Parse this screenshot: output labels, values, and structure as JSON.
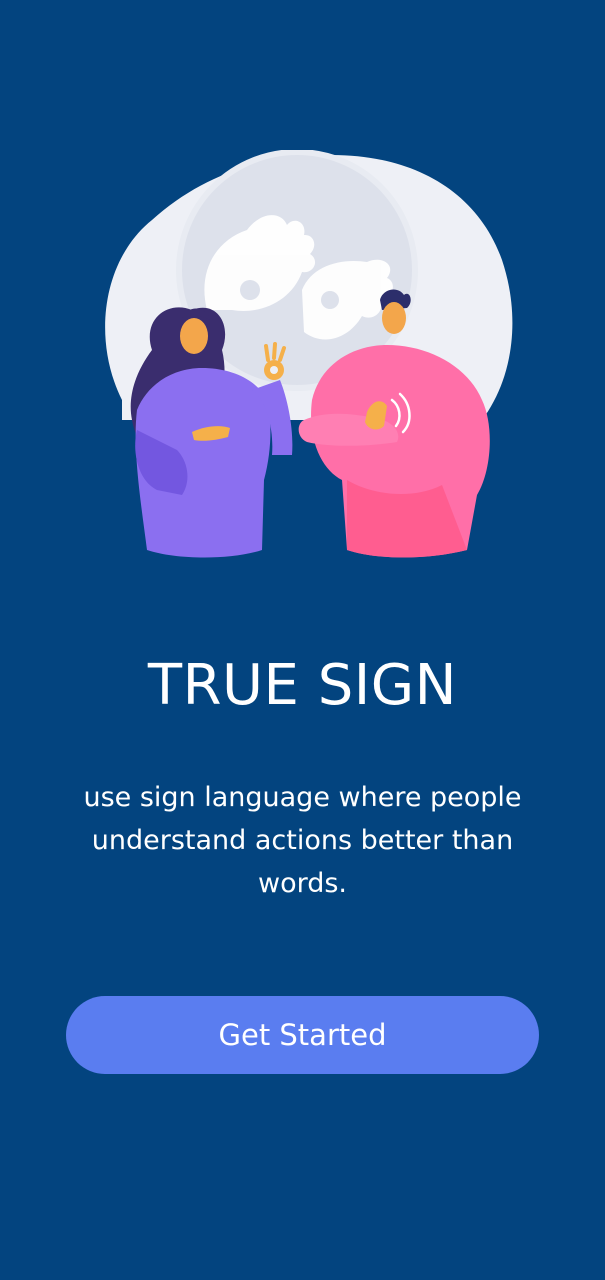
{
  "app": {
    "title": "TRUE SIGN",
    "tagline": "use sign language where people understand actions better than words.",
    "primary_action_label": "Get Started"
  },
  "illustration": {
    "name": "sign-language-people-illustration"
  },
  "colors": {
    "background": "#03447f",
    "button": "#5a7df0",
    "text": "#ffffff"
  }
}
